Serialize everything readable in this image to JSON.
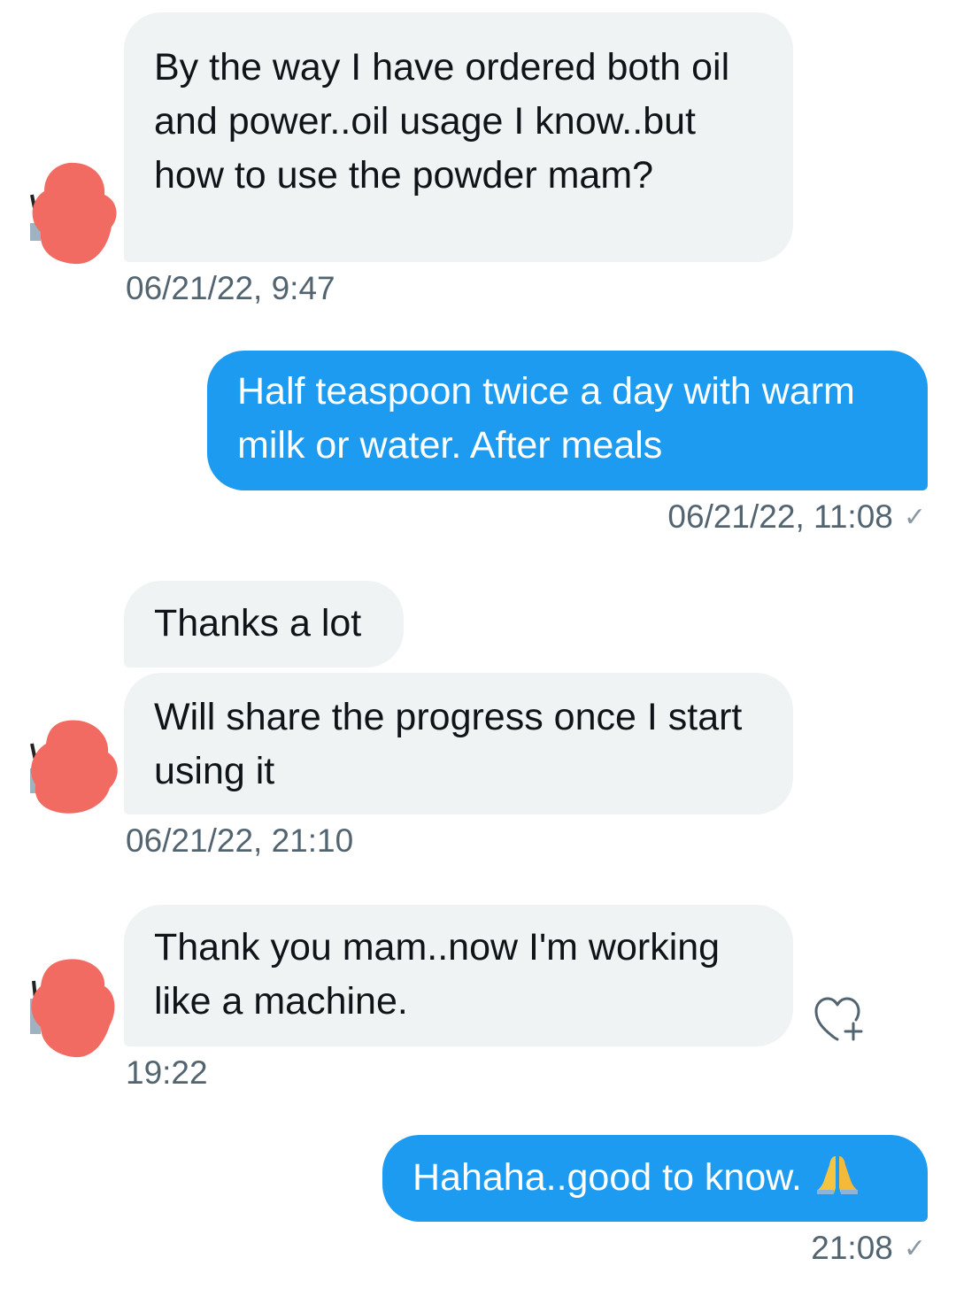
{
  "conversation": {
    "messages": [
      {
        "direction": "incoming",
        "text": "By the way I have ordered both oil and power..oil usage I know..but how to use the powder mam?",
        "timestamp": "06/21/22, 9:47"
      },
      {
        "direction": "outgoing",
        "text": "Half teaspoon twice a day with warm milk or water. After meals",
        "timestamp": "06/21/22, 11:08",
        "status_icon": "checkmark-icon"
      },
      {
        "direction": "incoming",
        "text": "Thanks a lot"
      },
      {
        "direction": "incoming",
        "text": "Will share the progress once I start using it",
        "timestamp": "06/21/22, 21:10"
      },
      {
        "direction": "incoming",
        "text": "Thank you mam..now I'm working like a machine.",
        "timestamp": "19:22",
        "reaction_icon": "add-reaction-heart-icon"
      },
      {
        "direction": "outgoing",
        "text": "Hahaha..good to know.",
        "emoji_icon": "folded-hands-emoji-icon",
        "timestamp": "21:08",
        "status_icon": "checkmark-icon"
      }
    ]
  },
  "colors": {
    "incoming_bubble": "#eff3f4",
    "outgoing_bubble": "#1d9bf0",
    "timestamp_text": "#536471",
    "avatar_redaction": "#f26b63"
  }
}
